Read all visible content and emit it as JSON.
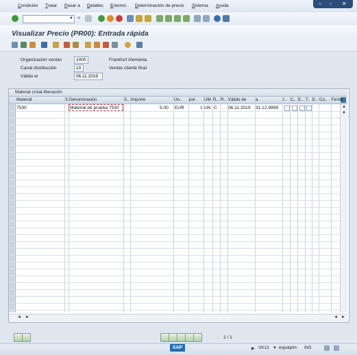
{
  "menu": [
    "Condición",
    "Tratar",
    "Pasar a",
    "Detalles",
    "Entorno",
    "Determinación de precio",
    "Sistema",
    "Ayuda"
  ],
  "title": "Visualizar Precio  (PR00): Entrada rápida",
  "header_fields": {
    "org_label": "Organización ventas",
    "org_value": "1000",
    "org_desc": "Frankfurt Alemania",
    "canal_label": "Canal distribución",
    "canal_value": "10",
    "canal_desc": "Ventas cliente final",
    "valido_label": "Válido el",
    "valido_value": "06.11.2019"
  },
  "table": {
    "title": "Material c/stat.liberación",
    "columns": [
      "Material",
      "S",
      "Denominación",
      "S..",
      "Importe",
      "Un..",
      "por",
      "UM",
      "R..",
      "R..",
      "Válido de",
      "a",
      "I..",
      "C..",
      "E..",
      "T..",
      "E..",
      "Co..",
      "FeVal"
    ],
    "rows": [
      {
        "material": "7530",
        "denominacion": "Material de prueba 7530",
        "importe": "5,00",
        "unidad": "EUR",
        "por": "1",
        "um": "UN",
        "r2": "C",
        "valido_de": "06.11.2019",
        "a": "31.12.9999"
      }
    ]
  },
  "pager": "1 / 1",
  "status": {
    "transaction": "VK13",
    "server": "erpukplm",
    "mode": "INS"
  }
}
